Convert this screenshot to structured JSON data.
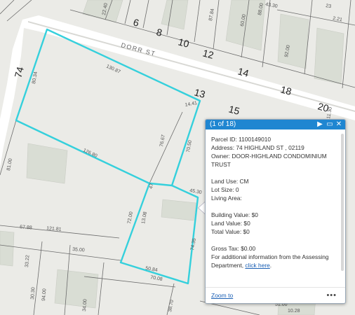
{
  "streets": {
    "dorr_st": "DORR ST"
  },
  "house_numbers": [
    "6",
    "8",
    "10",
    "12",
    "14",
    "18",
    "20",
    "74",
    "13",
    "15"
  ],
  "dimensions": [
    "130.87",
    "80.34",
    "81.00",
    "126.80",
    "76.67",
    "14.41",
    "70.50",
    "45.30",
    "47",
    "72.00",
    "13.08",
    "121.81",
    "35.00",
    "33.22",
    "67.88",
    "50.84",
    "70.08",
    "74.35",
    "38.70",
    "94.00",
    "30.30",
    "34.00",
    "22.40",
    "43.30",
    "60.00",
    "88.00",
    "23",
    "2.21",
    "11.30",
    "10.28",
    "51.00",
    "92.00",
    "87.84"
  ],
  "popup": {
    "counter": "(1 of 18)",
    "parcel_id": "Parcel ID: 1100149010",
    "address": "Address: 74 HIGHLAND ST , 02119",
    "owner": "Owner: DOOR-HIGHLAND CONDOMINIUM TRUST",
    "land_use": "Land Use:  CM",
    "lot_size": "Lot Size: 0",
    "living_area": "Living Area:",
    "building_value": "Building Value: $0",
    "land_value": "Land Value:  $0",
    "total_value": "Total Value: $0",
    "gross_tax": "Gross Tax: $0.00",
    "info_text": "For additional information from the Assessing Department, ",
    "info_link": "click here",
    "info_end": ".",
    "zoom_to": "Zoom to",
    "more": "•••",
    "next_icon": "play-right-icon",
    "maximize_icon": "maximize-icon",
    "close_icon": "close-icon"
  },
  "colors": {
    "parcel_highlight": "#35d0dc",
    "header": "#1f86d1",
    "building": "#d9ddd4",
    "road": "#ffffff"
  }
}
